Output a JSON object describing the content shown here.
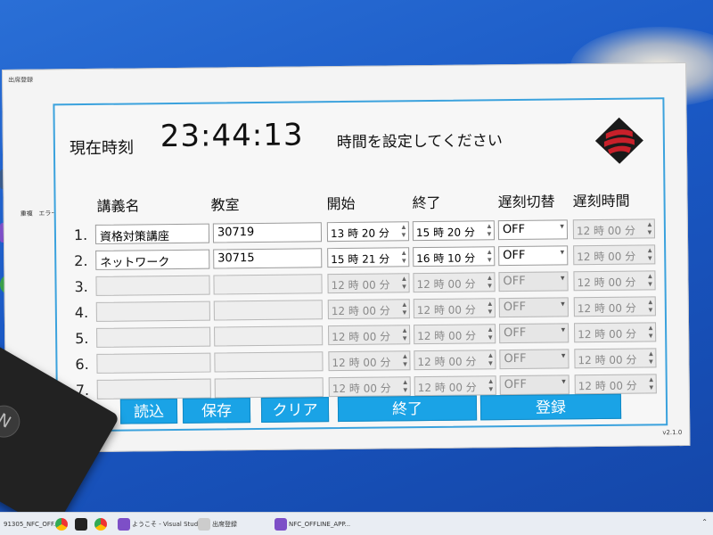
{
  "window": {
    "title": "出席登録",
    "version": "v2.1.0"
  },
  "side_labels": [
    "重複",
    "エラー"
  ],
  "clock": {
    "label": "現在時刻",
    "time": "23:44:13"
  },
  "message": "時間を設定してください",
  "columns": {
    "lecture": "講義名",
    "room": "教室",
    "start": "開始",
    "end": "終了",
    "late_switch": "遅刻切替",
    "late_time": "遅刻時間"
  },
  "rows": [
    {
      "num": "1.",
      "lecture": "資格対策講座",
      "room": "30719",
      "start": "13 時 20 分",
      "end": "15 時 20 分",
      "late": "OFF",
      "late_time": "12 時 00 分",
      "active": true
    },
    {
      "num": "2.",
      "lecture": "ネットワーク",
      "room": "30715",
      "start": "15 時 21 分",
      "end": "16 時 10 分",
      "late": "OFF",
      "late_time": "12 時 00 分",
      "active": true
    },
    {
      "num": "3.",
      "lecture": "",
      "room": "",
      "start": "12 時 00 分",
      "end": "12 時 00 分",
      "late": "OFF",
      "late_time": "12 時 00 分",
      "active": false
    },
    {
      "num": "4.",
      "lecture": "",
      "room": "",
      "start": "12 時 00 分",
      "end": "12 時 00 分",
      "late": "OFF",
      "late_time": "12 時 00 分",
      "active": false
    },
    {
      "num": "5.",
      "lecture": "",
      "room": "",
      "start": "12 時 00 分",
      "end": "12 時 00 分",
      "late": "OFF",
      "late_time": "12 時 00 分",
      "active": false
    },
    {
      "num": "6.",
      "lecture": "",
      "room": "",
      "start": "12 時 00 分",
      "end": "12 時 00 分",
      "late": "OFF",
      "late_time": "12 時 00 分",
      "active": false
    },
    {
      "num": "7.",
      "lecture": "",
      "room": "",
      "start": "12 時 00 分",
      "end": "12 時 00 分",
      "late": "OFF",
      "late_time": "12 時 00 分",
      "active": false
    }
  ],
  "buttons": {
    "load": "読込",
    "save": "保存",
    "clear": "クリア",
    "finish": "終了",
    "register": "登録"
  },
  "taskbar": {
    "items": [
      "91305_NFC_OFF...",
      "ようこそ - Visual Stud...",
      "出席登録",
      "NFC_OFFLINE_APP..."
    ]
  },
  "colors": {
    "accent": "#1aa3e6",
    "panel_border": "#3ba2dd",
    "desktop": "#1a58c4"
  }
}
